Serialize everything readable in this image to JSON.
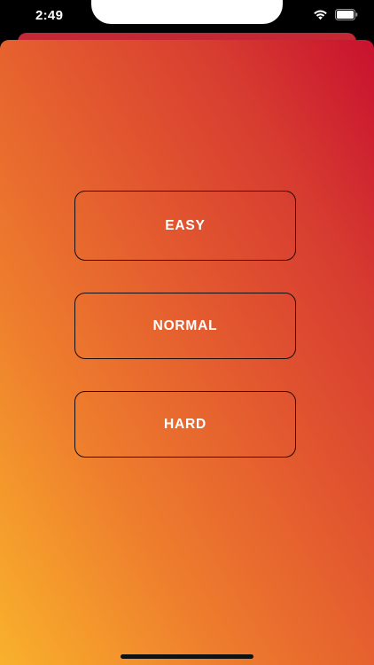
{
  "status_bar": {
    "time": "2:49",
    "icons": [
      "wifi-icon",
      "battery-icon"
    ]
  },
  "levels": {
    "easy": "EASY",
    "normal": "NORMAL",
    "hard": "HARD"
  },
  "colors": {
    "gradient_top_right": "#c8112f",
    "gradient_bottom_left": "#f9b12c",
    "button_border": "#1a0d08",
    "button_text": "#ffffff"
  }
}
